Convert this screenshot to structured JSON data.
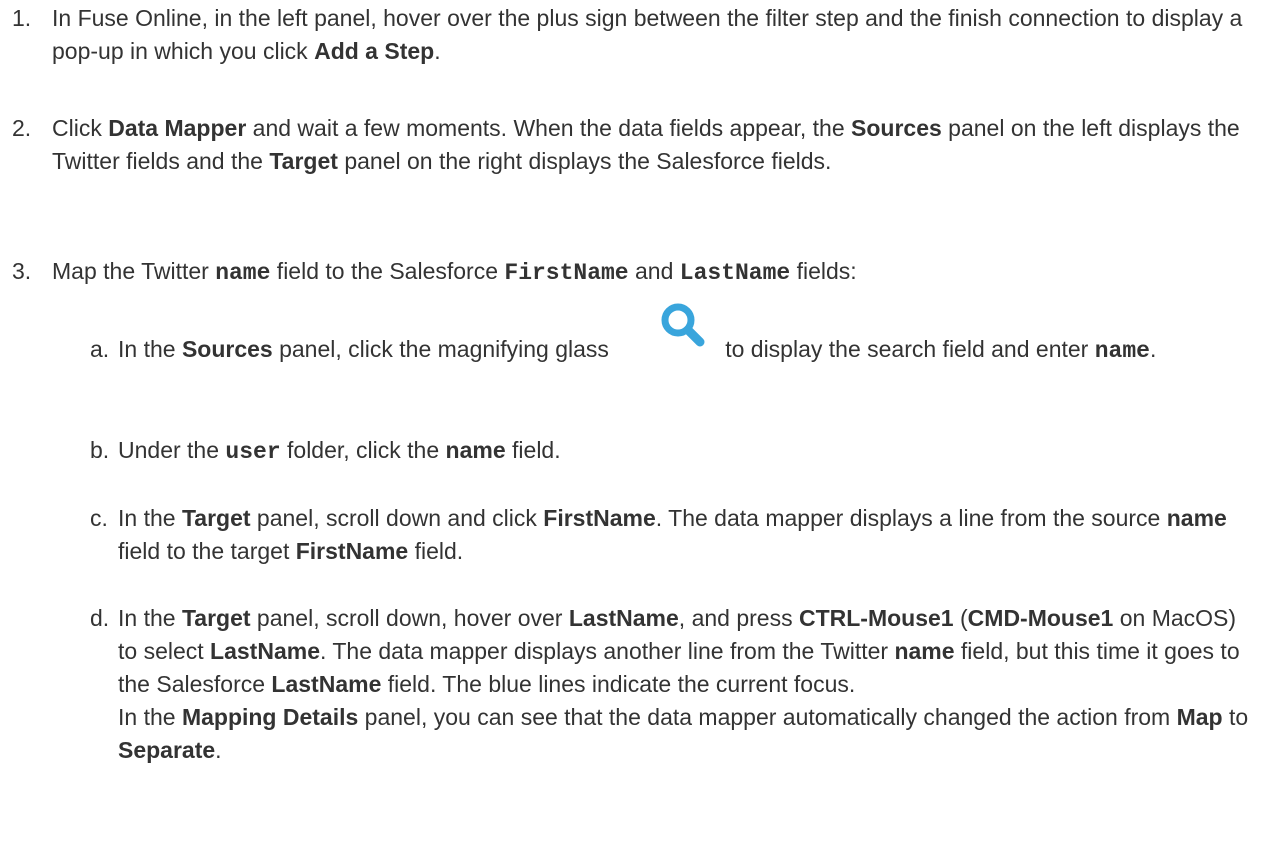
{
  "steps": [
    {
      "marker": "1.",
      "parts": [
        {
          "t": "In Fuse Online, in the left panel, hover over the plus sign between the filter step and the finish connection to display a pop-up in which you click "
        },
        {
          "b": "Add a Step"
        },
        {
          "t": "."
        }
      ]
    },
    {
      "marker": "2.",
      "parts": [
        {
          "t": "Click "
        },
        {
          "b": "Data Mapper"
        },
        {
          "t": " and wait a few moments. When the data fields appear, the "
        },
        {
          "b": "Sources"
        },
        {
          "t": " panel on the left displays the Twitter fields and the "
        },
        {
          "b": "Target"
        },
        {
          "t": " panel on the right displays the Salesforce fields."
        }
      ]
    },
    {
      "marker": "3.",
      "parts": [
        {
          "t": "Map the Twitter "
        },
        {
          "c": "name"
        },
        {
          "t": " field to the Salesforce "
        },
        {
          "c": "FirstName"
        },
        {
          "t": " and "
        },
        {
          "c": "LastName"
        },
        {
          "t": " fields:"
        }
      ]
    }
  ],
  "substeps": [
    {
      "marker": "a.",
      "parts": [
        {
          "t": "In the "
        },
        {
          "b": "Sources"
        },
        {
          "t": " panel, click the magnifying glass       to display the search field and enter "
        },
        {
          "c": "name"
        },
        {
          "t": "."
        }
      ]
    },
    {
      "marker": "b.",
      "parts": [
        {
          "t": "Under the "
        },
        {
          "c": "user"
        },
        {
          "t": " folder, click the "
        },
        {
          "b": "name"
        },
        {
          "t": " field."
        }
      ]
    },
    {
      "marker": "c.",
      "parts": [
        {
          "t": "In the "
        },
        {
          "b": "Target"
        },
        {
          "t": " panel, scroll down and click "
        },
        {
          "b": "FirstName"
        },
        {
          "t": ". The data mapper displays a line from the source "
        },
        {
          "b": "name"
        },
        {
          "t": " field to the target "
        },
        {
          "b": "FirstName"
        },
        {
          "t": " field."
        }
      ]
    },
    {
      "marker": "d.",
      "parts": [
        {
          "t": "In the "
        },
        {
          "b": "Target"
        },
        {
          "t": " panel, scroll down, hover over "
        },
        {
          "b": "LastName"
        },
        {
          "t": ", and press "
        },
        {
          "b": "CTRL-Mouse1"
        },
        {
          "t": " ("
        },
        {
          "b": "CMD-Mouse1"
        },
        {
          "t": " on MacOS) to select "
        },
        {
          "b": "LastName"
        },
        {
          "t": ". The data mapper displays another line from the Twitter "
        },
        {
          "b": "name"
        },
        {
          "t": " field, but this time it goes to the Salesforce "
        },
        {
          "b": "LastName"
        },
        {
          "t": " field. The blue lines indicate the current focus."
        },
        {
          "br": true
        },
        {
          "t": "In the "
        },
        {
          "b": "Mapping Details"
        },
        {
          "t": " panel, you can see that the data mapper automatically changed the action from "
        },
        {
          "b": "Map"
        },
        {
          "t": " to "
        },
        {
          "b": "Separate"
        },
        {
          "t": "."
        }
      ]
    }
  ],
  "icons": {
    "magnifier": {
      "name": "magnifying-glass-icon",
      "color": "#39a5dc"
    }
  }
}
